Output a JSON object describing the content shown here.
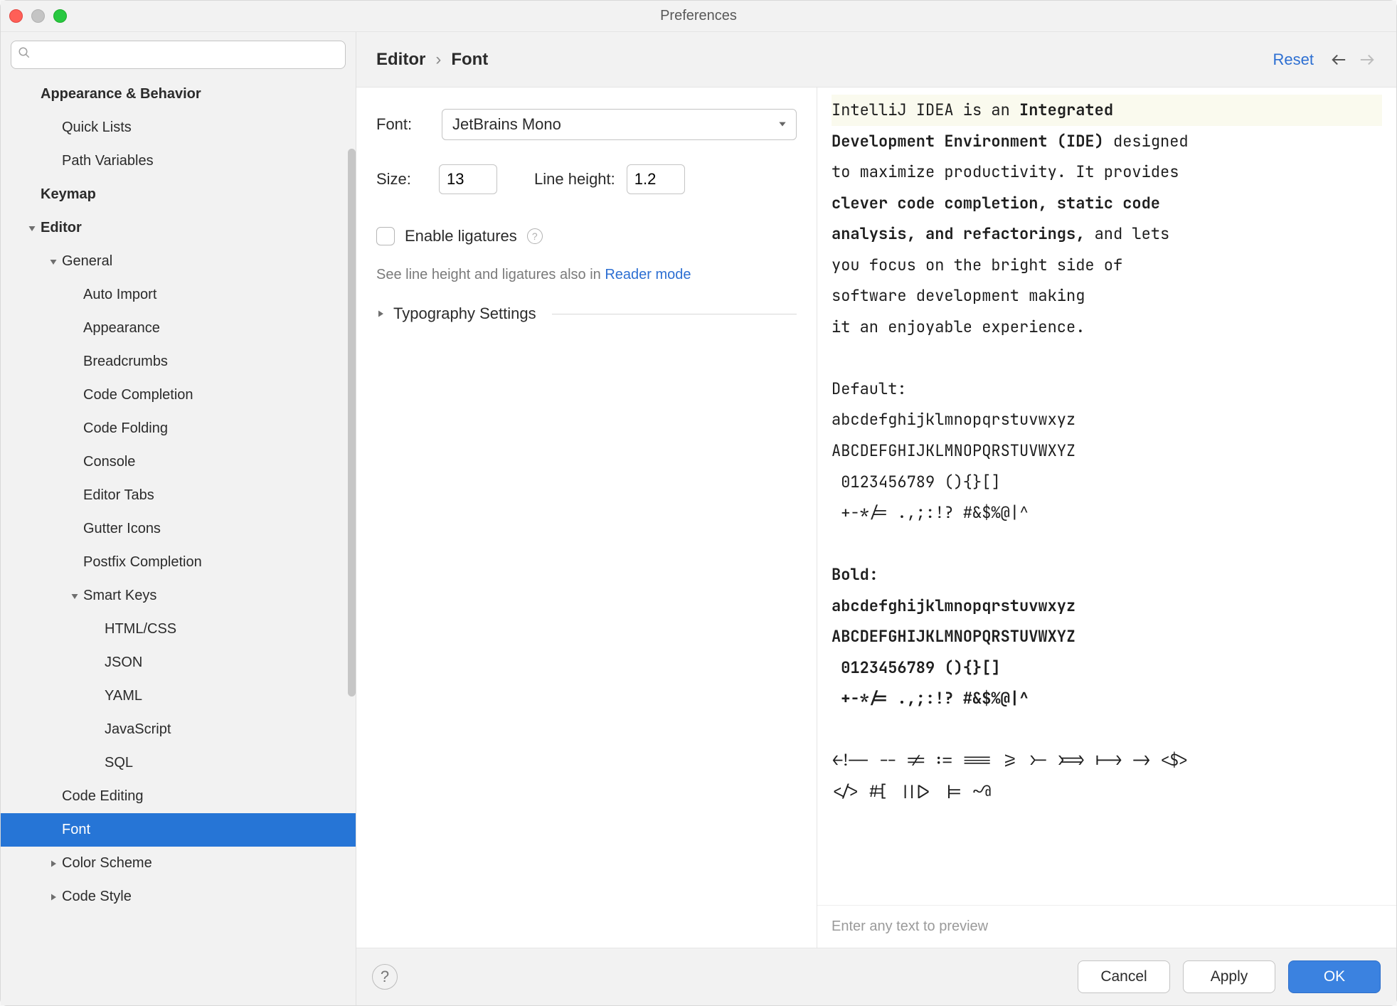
{
  "window": {
    "title": "Preferences"
  },
  "sidebar": {
    "search_placeholder": "",
    "items": [
      {
        "label": "Appearance & Behavior",
        "level": 0,
        "bold": true,
        "arrow": ""
      },
      {
        "label": "Quick Lists",
        "level": 1,
        "arrow": ""
      },
      {
        "label": "Path Variables",
        "level": 1,
        "arrow": ""
      },
      {
        "label": "Keymap",
        "level": 0,
        "bold": true,
        "arrow": ""
      },
      {
        "label": "Editor",
        "level": 0,
        "bold": true,
        "arrow": "down"
      },
      {
        "label": "General",
        "level": 1,
        "arrow": "down"
      },
      {
        "label": "Auto Import",
        "level": 2,
        "arrow": ""
      },
      {
        "label": "Appearance",
        "level": 2,
        "arrow": ""
      },
      {
        "label": "Breadcrumbs",
        "level": 2,
        "arrow": ""
      },
      {
        "label": "Code Completion",
        "level": 2,
        "arrow": ""
      },
      {
        "label": "Code Folding",
        "level": 2,
        "arrow": ""
      },
      {
        "label": "Console",
        "level": 2,
        "arrow": ""
      },
      {
        "label": "Editor Tabs",
        "level": 2,
        "arrow": ""
      },
      {
        "label": "Gutter Icons",
        "level": 2,
        "arrow": ""
      },
      {
        "label": "Postfix Completion",
        "level": 2,
        "arrow": ""
      },
      {
        "label": "Smart Keys",
        "level": 2,
        "arrow": "down"
      },
      {
        "label": "HTML/CSS",
        "level": 3,
        "arrow": ""
      },
      {
        "label": "JSON",
        "level": 3,
        "arrow": ""
      },
      {
        "label": "YAML",
        "level": 3,
        "arrow": ""
      },
      {
        "label": "JavaScript",
        "level": 3,
        "arrow": ""
      },
      {
        "label": "SQL",
        "level": 3,
        "arrow": ""
      },
      {
        "label": "Code Editing",
        "level": 1,
        "arrow": ""
      },
      {
        "label": "Font",
        "level": 1,
        "arrow": "",
        "selected": true
      },
      {
        "label": "Color Scheme",
        "level": 1,
        "arrow": "right"
      },
      {
        "label": "Code Style",
        "level": 1,
        "arrow": "right"
      }
    ]
  },
  "header": {
    "crumb1": "Editor",
    "crumb2": "Font",
    "reset": "Reset"
  },
  "settings": {
    "font_label": "Font:",
    "font_value": "JetBrains Mono",
    "size_label": "Size:",
    "size_value": "13",
    "lineheight_label": "Line height:",
    "lineheight_value": "1.2",
    "ligatures_label": "Enable ligatures",
    "hint_prefix": "See line height and ligatures also in ",
    "hint_link": "Reader mode",
    "typography_label": "Typography Settings"
  },
  "preview": {
    "l1a": "IntelliJ IDEA is an ",
    "l1b": "Integrated",
    "l2a": "Development Environment (IDE)",
    "l2b": " designed",
    "l3": "to maximize productivity. It provides",
    "l4a": "clever code completion, static code",
    "l5a": "analysis, and refactorings,",
    "l5b": " and lets",
    "l6": "you focus on the bright side of",
    "l7": "software development making",
    "l8": "it an enjoyable experience.",
    "blank": "",
    "d0": "Default:",
    "d1": "abcdefghijklmnopqrstuvwxyz",
    "d2": "ABCDEFGHIJKLMNOPQRSTUVWXYZ",
    "d3": " 0123456789 (){}[]",
    "d4": " +-*/= .,;:!? #&$%@|^",
    "b0": "Bold:",
    "b1": "abcdefghijklmnopqrstuvwxyz",
    "b2": "ABCDEFGHIJKLMNOPQRSTUVWXYZ",
    "b3": " 0123456789 (){}[]",
    "b4": " +-*/= .,;:!? #&$%@|^",
    "s1": "<!-- -- != := === >= >- >=> |-> -> <$>",
    "s2": "</> #[ |||> |= ~@",
    "footer": "Enter any text to preview"
  },
  "footer": {
    "cancel": "Cancel",
    "apply": "Apply",
    "ok": "OK"
  }
}
